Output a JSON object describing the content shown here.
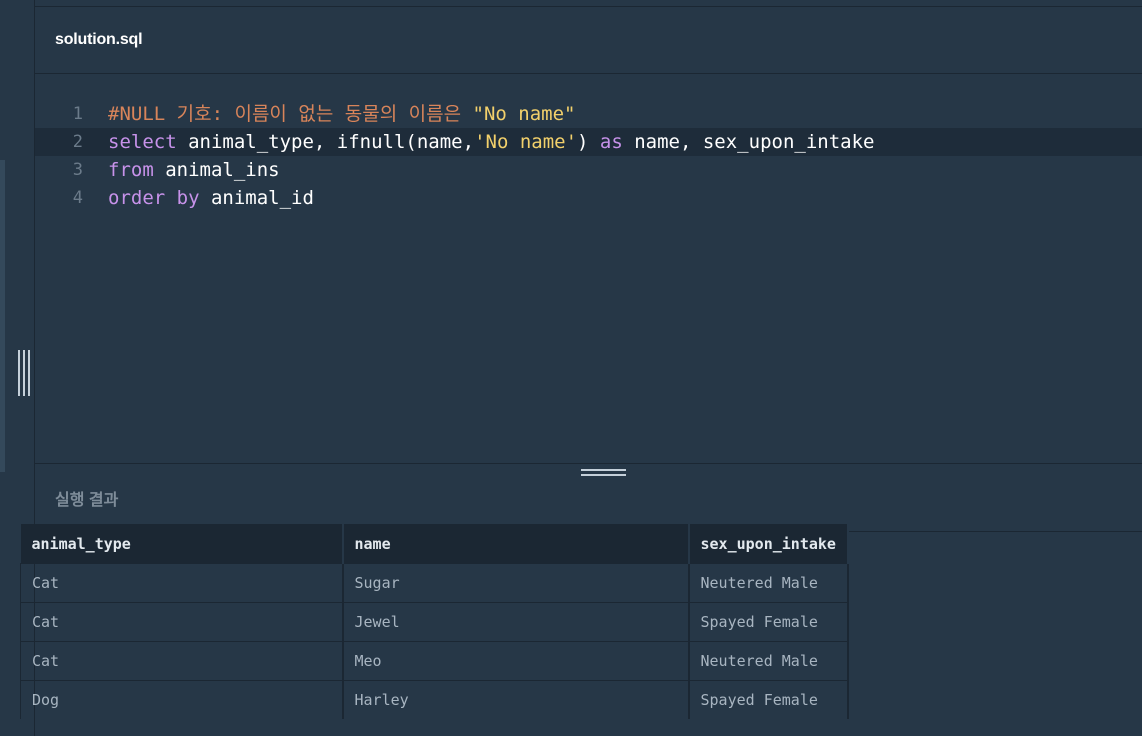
{
  "file": {
    "name": "solution.sql"
  },
  "editor": {
    "lines": [
      {
        "no": "1",
        "tokens": [
          {
            "cls": "tk-comment",
            "text": "#NULL 기호: 이름이 없는 동물의 이름은 "
          },
          {
            "cls": "tk-str",
            "text": "\"No name\""
          }
        ]
      },
      {
        "no": "2",
        "active": true,
        "tokens": [
          {
            "cls": "tk-kw",
            "text": "select"
          },
          {
            "cls": "tk-plain",
            "text": " animal_type, ifnull(name,"
          },
          {
            "cls": "tk-str",
            "text": "'No name'"
          },
          {
            "cls": "tk-plain",
            "text": ") "
          },
          {
            "cls": "tk-kw",
            "text": "as"
          },
          {
            "cls": "tk-plain",
            "text": " name, sex_upon_intake"
          }
        ]
      },
      {
        "no": "3",
        "tokens": [
          {
            "cls": "tk-kw",
            "text": "from"
          },
          {
            "cls": "tk-plain",
            "text": " animal_ins"
          }
        ]
      },
      {
        "no": "4",
        "tokens": [
          {
            "cls": "tk-kw",
            "text": "order by"
          },
          {
            "cls": "tk-plain",
            "text": " animal_id"
          }
        ]
      }
    ]
  },
  "results": {
    "title": "실행 결과",
    "columns": [
      "animal_type",
      "name",
      "sex_upon_intake"
    ],
    "rows": [
      [
        "Cat",
        "Sugar",
        "Neutered Male"
      ],
      [
        "Cat",
        "Jewel",
        "Spayed Female"
      ],
      [
        "Cat",
        "Meo",
        "Neutered Male"
      ],
      [
        "Dog",
        "Harley",
        "Spayed Female"
      ]
    ]
  },
  "icons": {
    "vertical_resize": "vertical-resize-handle-icon",
    "horizontal_resize": "horizontal-resize-handle-icon"
  }
}
